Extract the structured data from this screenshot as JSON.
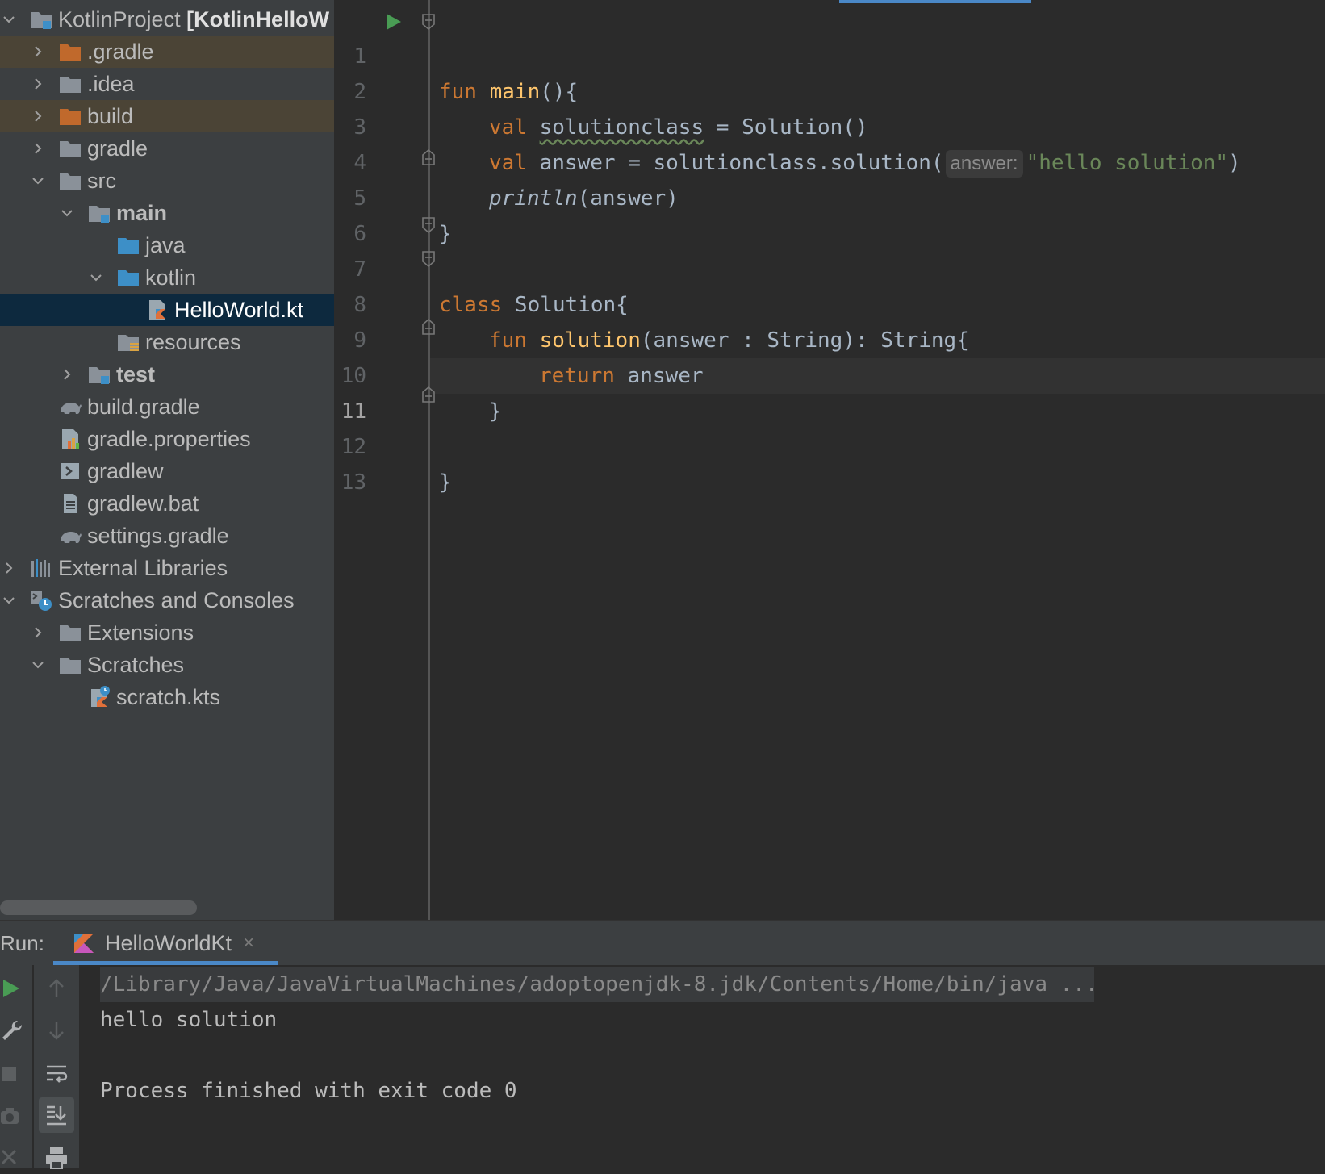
{
  "project_tree": {
    "root": {
      "name": "KotlinProject",
      "module": "[KotlinHelloW"
    },
    "items": [
      {
        "label": ".gradle"
      },
      {
        "label": ".idea"
      },
      {
        "label": "build"
      },
      {
        "label": "gradle"
      },
      {
        "label": "src"
      },
      {
        "label": "main"
      },
      {
        "label": "java"
      },
      {
        "label": "kotlin"
      },
      {
        "label": "HelloWorld.kt"
      },
      {
        "label": "resources"
      },
      {
        "label": "test"
      },
      {
        "label": "build.gradle"
      },
      {
        "label": "gradle.properties"
      },
      {
        "label": "gradlew"
      },
      {
        "label": "gradlew.bat"
      },
      {
        "label": "settings.gradle"
      },
      {
        "label": "External Libraries"
      },
      {
        "label": "Scratches and Consoles"
      },
      {
        "label": "Extensions"
      },
      {
        "label": "Scratches"
      },
      {
        "label": "scratch.kts"
      }
    ]
  },
  "editor": {
    "line_numbers": [
      "1",
      "2",
      "3",
      "4",
      "5",
      "6",
      "7",
      "8",
      "9",
      "10",
      "11",
      "12",
      "13"
    ],
    "current_line": "11",
    "code": {
      "l1_kw": "fun",
      "l1_fn": "main",
      "l1_rest": "(){",
      "l2_kw": "val",
      "l2_var": "solutionclass",
      "l2_rest": " = Solution()",
      "l3_kw": "val",
      "l3_rest": " answer = solutionclass.solution(",
      "l3_hint": "answer:",
      "l3_str": "\"hello solution\"",
      "l3_end": ")",
      "l4_fn": "println",
      "l4_rest": "(answer)",
      "l5": "}",
      "l7_kw": "class",
      "l7_rest": " Solution{",
      "l8_kw": "fun",
      "l8_fn": "solution",
      "l8_rest": "(answer : String): String{",
      "l9_kw": "return",
      "l9_rest": " answer",
      "l10": "}",
      "l12": "}"
    }
  },
  "run_window": {
    "label": "Run:",
    "tab_label": "HelloWorldKt",
    "tab_close": "×",
    "console": {
      "command": "/Library/Java/JavaVirtualMachines/adoptopenjdk-8.jdk/Contents/Home/bin/java ...",
      "output": "hello solution",
      "exit": "Process finished with exit code 0"
    }
  },
  "colors": {
    "keyword": "#cc7832",
    "function": "#ffc66d",
    "string": "#6a8759",
    "text": "#a9b7c6",
    "selection": "#0d293e",
    "excluded_folder": "#c0692c",
    "folder": "#8a9199",
    "source_folder": "#3d8fc7"
  }
}
